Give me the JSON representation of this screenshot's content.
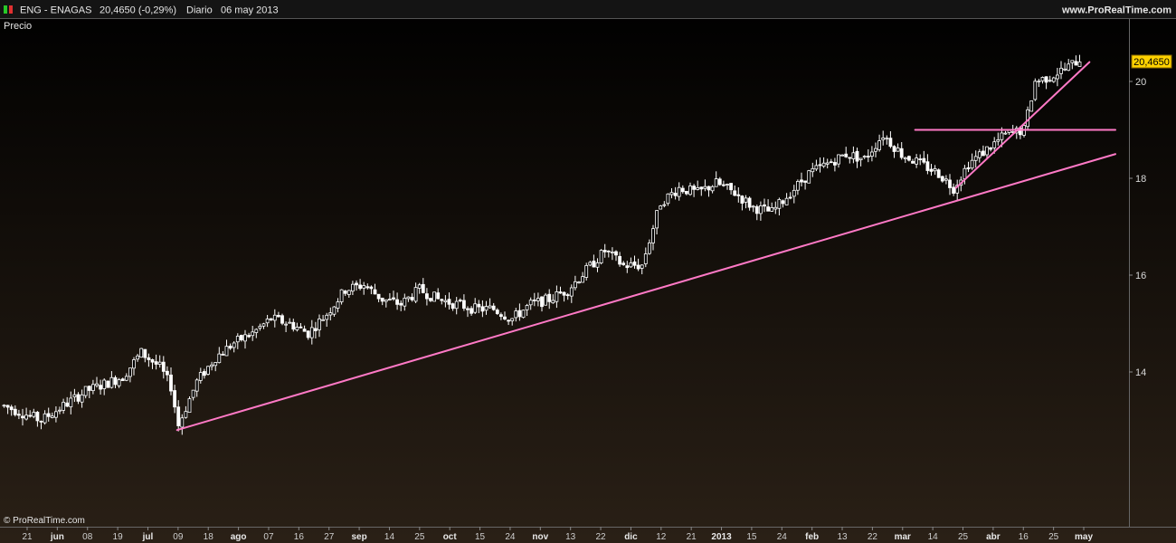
{
  "header": {
    "symbol": "ENG - ENAGAS",
    "price_change": "20,4650 (-0,29%)",
    "period": "Diario",
    "date": "06 may 2013",
    "brand": "www.ProRealTime.com"
  },
  "panel_label": "Precio",
  "copyright": "© ProRealTime.com",
  "colors": {
    "background_top": "#000000",
    "background_bottom": "#2a2016",
    "bar": "#ffffff",
    "trendline": "#ff79c6",
    "last_price_bg": "#ffd200",
    "indicator_green": "#28c828",
    "indicator_red": "#e03030"
  },
  "chart_data": {
    "type": "candlestick",
    "period": "Diario",
    "x_ticks": [
      {
        "label": "21",
        "bold": false
      },
      {
        "label": "jun",
        "bold": true
      },
      {
        "label": "08",
        "bold": false
      },
      {
        "label": "19",
        "bold": false
      },
      {
        "label": "jul",
        "bold": true
      },
      {
        "label": "09",
        "bold": false
      },
      {
        "label": "18",
        "bold": false
      },
      {
        "label": "ago",
        "bold": true
      },
      {
        "label": "07",
        "bold": false
      },
      {
        "label": "16",
        "bold": false
      },
      {
        "label": "27",
        "bold": false
      },
      {
        "label": "sep",
        "bold": true
      },
      {
        "label": "14",
        "bold": false
      },
      {
        "label": "25",
        "bold": false
      },
      {
        "label": "oct",
        "bold": true
      },
      {
        "label": "15",
        "bold": false
      },
      {
        "label": "24",
        "bold": false
      },
      {
        "label": "nov",
        "bold": true
      },
      {
        "label": "13",
        "bold": false
      },
      {
        "label": "22",
        "bold": false
      },
      {
        "label": "dic",
        "bold": true
      },
      {
        "label": "12",
        "bold": false
      },
      {
        "label": "21",
        "bold": false
      },
      {
        "label": "2013",
        "bold": true
      },
      {
        "label": "15",
        "bold": false
      },
      {
        "label": "24",
        "bold": false
      },
      {
        "label": "feb",
        "bold": true
      },
      {
        "label": "13",
        "bold": false
      },
      {
        "label": "22",
        "bold": false
      },
      {
        "label": "mar",
        "bold": true
      },
      {
        "label": "14",
        "bold": false
      },
      {
        "label": "25",
        "bold": false
      },
      {
        "label": "abr",
        "bold": true
      },
      {
        "label": "16",
        "bold": false
      },
      {
        "label": "25",
        "bold": false
      },
      {
        "label": "may",
        "bold": true
      }
    ],
    "y_ticks": [
      14,
      16,
      18,
      20
    ],
    "last_price": "20,4650",
    "last_value": 20.465,
    "trend_path": [
      [
        0,
        13.3
      ],
      [
        10,
        13.0
      ],
      [
        22,
        13.6
      ],
      [
        32,
        13.9
      ],
      [
        37,
        14.4
      ],
      [
        42,
        14.1
      ],
      [
        45,
        13.7
      ],
      [
        47,
        12.9
      ],
      [
        52,
        13.8
      ],
      [
        57,
        14.3
      ],
      [
        62,
        14.6
      ],
      [
        67,
        14.8
      ],
      [
        72,
        15.1
      ],
      [
        77,
        15.0
      ],
      [
        82,
        14.8
      ],
      [
        87,
        15.2
      ],
      [
        92,
        15.7
      ],
      [
        97,
        15.8
      ],
      [
        102,
        15.5
      ],
      [
        107,
        15.4
      ],
      [
        112,
        15.7
      ],
      [
        117,
        15.5
      ],
      [
        122,
        15.4
      ],
      [
        127,
        15.3
      ],
      [
        132,
        15.3
      ],
      [
        137,
        15.1
      ],
      [
        142,
        15.4
      ],
      [
        147,
        15.5
      ],
      [
        152,
        15.7
      ],
      [
        157,
        16.1
      ],
      [
        162,
        16.5
      ],
      [
        167,
        16.2
      ],
      [
        172,
        16.2
      ],
      [
        177,
        17.5
      ],
      [
        182,
        17.8
      ],
      [
        187,
        17.7
      ],
      [
        192,
        17.9
      ],
      [
        197,
        17.7
      ],
      [
        202,
        17.4
      ],
      [
        207,
        17.3
      ],
      [
        212,
        17.7
      ],
      [
        217,
        18.1
      ],
      [
        222,
        18.3
      ],
      [
        227,
        18.5
      ],
      [
        232,
        18.4
      ],
      [
        237,
        18.9
      ],
      [
        242,
        18.5
      ],
      [
        247,
        18.3
      ],
      [
        252,
        18.1
      ],
      [
        256,
        17.8
      ],
      [
        260,
        18.3
      ],
      [
        265,
        18.6
      ],
      [
        270,
        18.9
      ],
      [
        275,
        19.0
      ],
      [
        278,
        20.0
      ],
      [
        282,
        20.1
      ],
      [
        287,
        20.3
      ],
      [
        290,
        20.465
      ]
    ],
    "trendlines": [
      {
        "from": [
          47,
          12.8
        ],
        "to": [
          300,
          18.5
        ]
      },
      {
        "from": [
          246,
          19.0
        ],
        "to": [
          300,
          19.0
        ]
      },
      {
        "from": [
          257,
          17.8
        ],
        "to": [
          293,
          20.4
        ]
      }
    ]
  }
}
